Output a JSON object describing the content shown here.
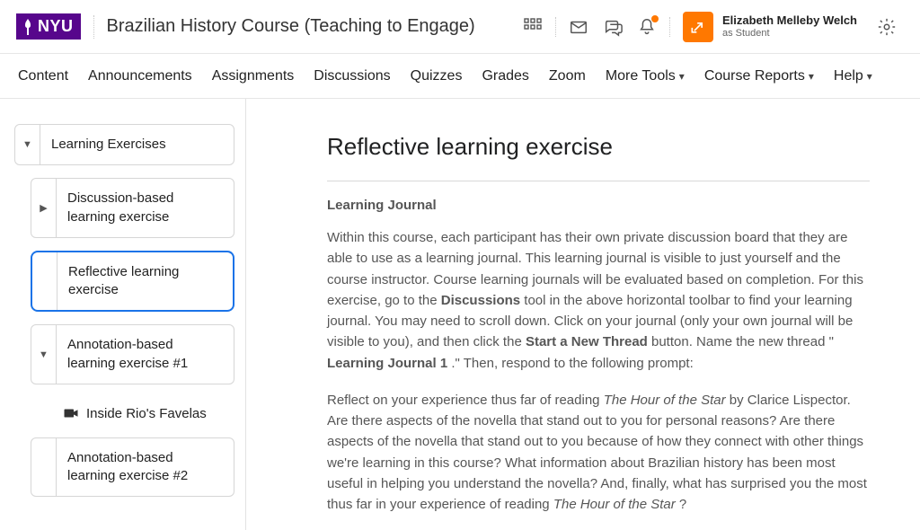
{
  "header": {
    "logo_text": "NYU",
    "course_title": "Brazilian History Course (Teaching to Engage)"
  },
  "user": {
    "name": "Elizabeth Melleby Welch",
    "role": "as Student"
  },
  "nav": {
    "items": [
      "Content",
      "Announcements",
      "Assignments",
      "Discussions",
      "Quizzes",
      "Grades",
      "Zoom",
      "More Tools",
      "Course Reports",
      "Help"
    ],
    "dropdown_indices": [
      7,
      8,
      9
    ]
  },
  "sidebar": {
    "root": "Learning Exercises",
    "items": [
      {
        "label": "Discussion-based learning exercise",
        "expandable": true,
        "expanded": false,
        "selected": false
      },
      {
        "label": "Reflective learning exercise",
        "expandable": false,
        "expanded": false,
        "selected": true
      },
      {
        "label": "Annotation-based learning exercise #1",
        "expandable": true,
        "expanded": true,
        "selected": false
      },
      {
        "label": "Inside Rio's Favelas",
        "leaf": true
      },
      {
        "label": "Annotation-based learning exercise #2",
        "expandable": false,
        "expanded": false,
        "selected": false
      }
    ]
  },
  "content": {
    "title": "Reflective learning exercise",
    "subhead": "Learning Journal",
    "p1_a": "Within this course, each participant has their own private discussion board that they are able to use as a learning journal. This learning journal is visible to just yourself and the course instructor. Course learning journals will be evaluated based on completion. For this exercise, go to the ",
    "p1_b1": "Discussions",
    "p1_c": " tool in the above horizontal toolbar to find your learning journal. You may need to scroll down. Click on your journal (only your own journal will be visible to you), and then click the ",
    "p1_b2": "Start a New Thread",
    "p1_d": " button. Name the new thread \"",
    "p1_b3": "Learning Journal 1",
    "p1_e": ".\" Then, respond to the following prompt:",
    "p2_a": "Reflect on your experience thus far of reading ",
    "p2_i1": "The Hour of the Star",
    "p2_b": " by Clarice Lispector. Are there aspects of the novella that stand out to you for personal reasons? Are there aspects of the novella that stand out to you because of how they connect with other things we're learning in this course? What information about Brazilian history has been most useful in helping you understand the novella? And, finally, what has surprised you the most thus far in your experience of reading ",
    "p2_i2": "The Hour of the Star",
    "p2_c": "?"
  },
  "colors": {
    "brand": "#57068c",
    "accent": "#ff7800",
    "selection": "#1a73e8"
  }
}
